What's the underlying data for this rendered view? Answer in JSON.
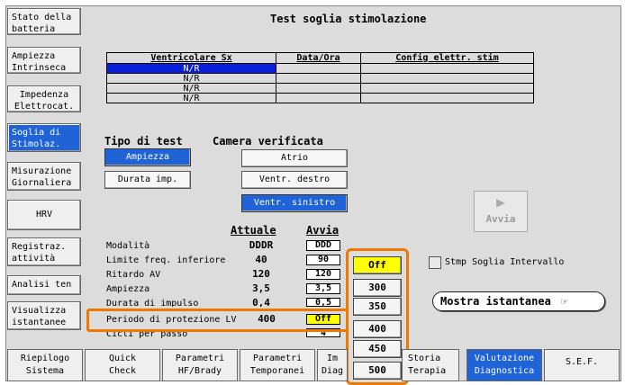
{
  "title": "Test soglia stimolazione",
  "sidebar": [
    {
      "label": "Stato della\nbatteria"
    },
    {
      "label": "Ampiezza\nIntrinseca"
    },
    {
      "label": "Impedenza\nElettrocat."
    },
    {
      "label": "Soglia di\nStimolaz."
    },
    {
      "label": "Misurazione\nGiornaliera"
    },
    {
      "label": "HRV"
    },
    {
      "label": "Registraz.\nattività"
    },
    {
      "label": "Analisi ten"
    },
    {
      "label": "Visualizza\nistantanee"
    }
  ],
  "results_table": {
    "headers": [
      "Ventricolare Sx",
      "Data/Ora",
      "Config elettr. stim"
    ],
    "rows": [
      [
        "N/R",
        "",
        ""
      ],
      [
        "N/R",
        "",
        ""
      ],
      [
        "N/R",
        "",
        ""
      ],
      [
        "N/R",
        "",
        ""
      ]
    ]
  },
  "test_type": {
    "label": "Tipo di test",
    "options": [
      "Ampiezza",
      "Durata imp."
    ]
  },
  "chamber": {
    "label": "Camera verificata",
    "options": [
      "Atrio",
      "Ventr. destro",
      "Ventr. sinistro"
    ]
  },
  "run_button": "Avvia",
  "columns": {
    "current": "Attuale",
    "start": "Avvia"
  },
  "params": [
    {
      "label": "Modalità",
      "current": "DDDR",
      "start": "DDD"
    },
    {
      "label": "Limite freq. inferiore",
      "current": "40",
      "start": "90"
    },
    {
      "label": "Ritardo AV",
      "current": "120",
      "start": "120"
    },
    {
      "label": "Ampiezza",
      "current": "3,5",
      "start": "3,5"
    },
    {
      "label": "Durata di impulso",
      "current": "0,4",
      "start": "0,5"
    },
    {
      "label": "Periodo di protezione LV",
      "current": "400",
      "start": "Off"
    },
    {
      "label": "Cicli per passo",
      "current": "",
      "start": "4"
    }
  ],
  "dropdown_options": [
    "Off",
    "300",
    "350",
    "400",
    "450",
    "500"
  ],
  "checkbox_label": "Stmp Soglia Intervallo",
  "snapshot_button": "Mostra istantanea",
  "bottom_tabs": [
    {
      "label": "Riepilogo\nSistema"
    },
    {
      "label": "Quick\nCheck"
    },
    {
      "label": "Parametri\nHF/Brady"
    },
    {
      "label": "Parametri\nTemporanei"
    },
    {
      "label": "Im\nDiag"
    },
    {
      "label": "Storia\nTerapia"
    },
    {
      "label": "Valutazione\nDiagnostica"
    },
    {
      "label": "S.E.F."
    }
  ],
  "colors": {
    "highlight": "#f07800",
    "selected": "#1f63d6",
    "table_selected": "#0a1fdc",
    "yellow": "#ffff00"
  }
}
